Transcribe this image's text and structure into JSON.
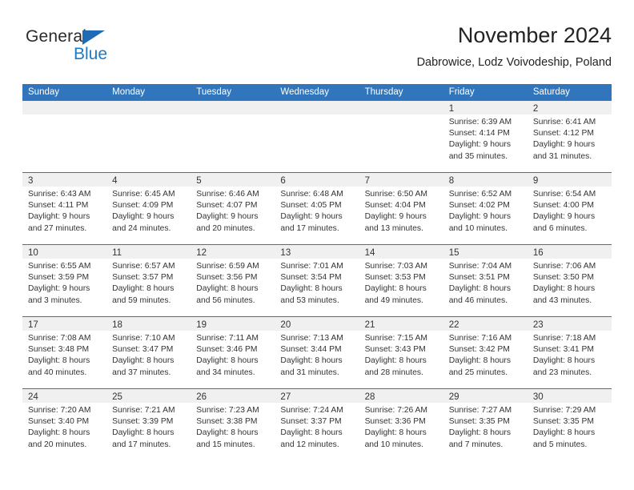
{
  "brand": {
    "name_part1": "General",
    "name_part2": "Blue",
    "accent_color": "#1f7ac4",
    "triangle_color": "#1f6cb4"
  },
  "header": {
    "month_title": "November 2024",
    "location": "Dabrowice, Lodz Voivodeship, Poland"
  },
  "calendar": {
    "header_bg_color": "#3176bc",
    "day_band_color": "#f0f0f0",
    "weekdays": [
      "Sunday",
      "Monday",
      "Tuesday",
      "Wednesday",
      "Thursday",
      "Friday",
      "Saturday"
    ],
    "weeks": [
      [
        {
          "day": "",
          "lines": []
        },
        {
          "day": "",
          "lines": []
        },
        {
          "day": "",
          "lines": []
        },
        {
          "day": "",
          "lines": []
        },
        {
          "day": "",
          "lines": []
        },
        {
          "day": "1",
          "lines": [
            "Sunrise: 6:39 AM",
            "Sunset: 4:14 PM",
            "Daylight: 9 hours",
            "and 35 minutes."
          ]
        },
        {
          "day": "2",
          "lines": [
            "Sunrise: 6:41 AM",
            "Sunset: 4:12 PM",
            "Daylight: 9 hours",
            "and 31 minutes."
          ]
        }
      ],
      [
        {
          "day": "3",
          "lines": [
            "Sunrise: 6:43 AM",
            "Sunset: 4:11 PM",
            "Daylight: 9 hours",
            "and 27 minutes."
          ]
        },
        {
          "day": "4",
          "lines": [
            "Sunrise: 6:45 AM",
            "Sunset: 4:09 PM",
            "Daylight: 9 hours",
            "and 24 minutes."
          ]
        },
        {
          "day": "5",
          "lines": [
            "Sunrise: 6:46 AM",
            "Sunset: 4:07 PM",
            "Daylight: 9 hours",
            "and 20 minutes."
          ]
        },
        {
          "day": "6",
          "lines": [
            "Sunrise: 6:48 AM",
            "Sunset: 4:05 PM",
            "Daylight: 9 hours",
            "and 17 minutes."
          ]
        },
        {
          "day": "7",
          "lines": [
            "Sunrise: 6:50 AM",
            "Sunset: 4:04 PM",
            "Daylight: 9 hours",
            "and 13 minutes."
          ]
        },
        {
          "day": "8",
          "lines": [
            "Sunrise: 6:52 AM",
            "Sunset: 4:02 PM",
            "Daylight: 9 hours",
            "and 10 minutes."
          ]
        },
        {
          "day": "9",
          "lines": [
            "Sunrise: 6:54 AM",
            "Sunset: 4:00 PM",
            "Daylight: 9 hours",
            "and 6 minutes."
          ]
        }
      ],
      [
        {
          "day": "10",
          "lines": [
            "Sunrise: 6:55 AM",
            "Sunset: 3:59 PM",
            "Daylight: 9 hours",
            "and 3 minutes."
          ]
        },
        {
          "day": "11",
          "lines": [
            "Sunrise: 6:57 AM",
            "Sunset: 3:57 PM",
            "Daylight: 8 hours",
            "and 59 minutes."
          ]
        },
        {
          "day": "12",
          "lines": [
            "Sunrise: 6:59 AM",
            "Sunset: 3:56 PM",
            "Daylight: 8 hours",
            "and 56 minutes."
          ]
        },
        {
          "day": "13",
          "lines": [
            "Sunrise: 7:01 AM",
            "Sunset: 3:54 PM",
            "Daylight: 8 hours",
            "and 53 minutes."
          ]
        },
        {
          "day": "14",
          "lines": [
            "Sunrise: 7:03 AM",
            "Sunset: 3:53 PM",
            "Daylight: 8 hours",
            "and 49 minutes."
          ]
        },
        {
          "day": "15",
          "lines": [
            "Sunrise: 7:04 AM",
            "Sunset: 3:51 PM",
            "Daylight: 8 hours",
            "and 46 minutes."
          ]
        },
        {
          "day": "16",
          "lines": [
            "Sunrise: 7:06 AM",
            "Sunset: 3:50 PM",
            "Daylight: 8 hours",
            "and 43 minutes."
          ]
        }
      ],
      [
        {
          "day": "17",
          "lines": [
            "Sunrise: 7:08 AM",
            "Sunset: 3:48 PM",
            "Daylight: 8 hours",
            "and 40 minutes."
          ]
        },
        {
          "day": "18",
          "lines": [
            "Sunrise: 7:10 AM",
            "Sunset: 3:47 PM",
            "Daylight: 8 hours",
            "and 37 minutes."
          ]
        },
        {
          "day": "19",
          "lines": [
            "Sunrise: 7:11 AM",
            "Sunset: 3:46 PM",
            "Daylight: 8 hours",
            "and 34 minutes."
          ]
        },
        {
          "day": "20",
          "lines": [
            "Sunrise: 7:13 AM",
            "Sunset: 3:44 PM",
            "Daylight: 8 hours",
            "and 31 minutes."
          ]
        },
        {
          "day": "21",
          "lines": [
            "Sunrise: 7:15 AM",
            "Sunset: 3:43 PM",
            "Daylight: 8 hours",
            "and 28 minutes."
          ]
        },
        {
          "day": "22",
          "lines": [
            "Sunrise: 7:16 AM",
            "Sunset: 3:42 PM",
            "Daylight: 8 hours",
            "and 25 minutes."
          ]
        },
        {
          "day": "23",
          "lines": [
            "Sunrise: 7:18 AM",
            "Sunset: 3:41 PM",
            "Daylight: 8 hours",
            "and 23 minutes."
          ]
        }
      ],
      [
        {
          "day": "24",
          "lines": [
            "Sunrise: 7:20 AM",
            "Sunset: 3:40 PM",
            "Daylight: 8 hours",
            "and 20 minutes."
          ]
        },
        {
          "day": "25",
          "lines": [
            "Sunrise: 7:21 AM",
            "Sunset: 3:39 PM",
            "Daylight: 8 hours",
            "and 17 minutes."
          ]
        },
        {
          "day": "26",
          "lines": [
            "Sunrise: 7:23 AM",
            "Sunset: 3:38 PM",
            "Daylight: 8 hours",
            "and 15 minutes."
          ]
        },
        {
          "day": "27",
          "lines": [
            "Sunrise: 7:24 AM",
            "Sunset: 3:37 PM",
            "Daylight: 8 hours",
            "and 12 minutes."
          ]
        },
        {
          "day": "28",
          "lines": [
            "Sunrise: 7:26 AM",
            "Sunset: 3:36 PM",
            "Daylight: 8 hours",
            "and 10 minutes."
          ]
        },
        {
          "day": "29",
          "lines": [
            "Sunrise: 7:27 AM",
            "Sunset: 3:35 PM",
            "Daylight: 8 hours",
            "and 7 minutes."
          ]
        },
        {
          "day": "30",
          "lines": [
            "Sunrise: 7:29 AM",
            "Sunset: 3:35 PM",
            "Daylight: 8 hours",
            "and 5 minutes."
          ]
        }
      ]
    ]
  }
}
